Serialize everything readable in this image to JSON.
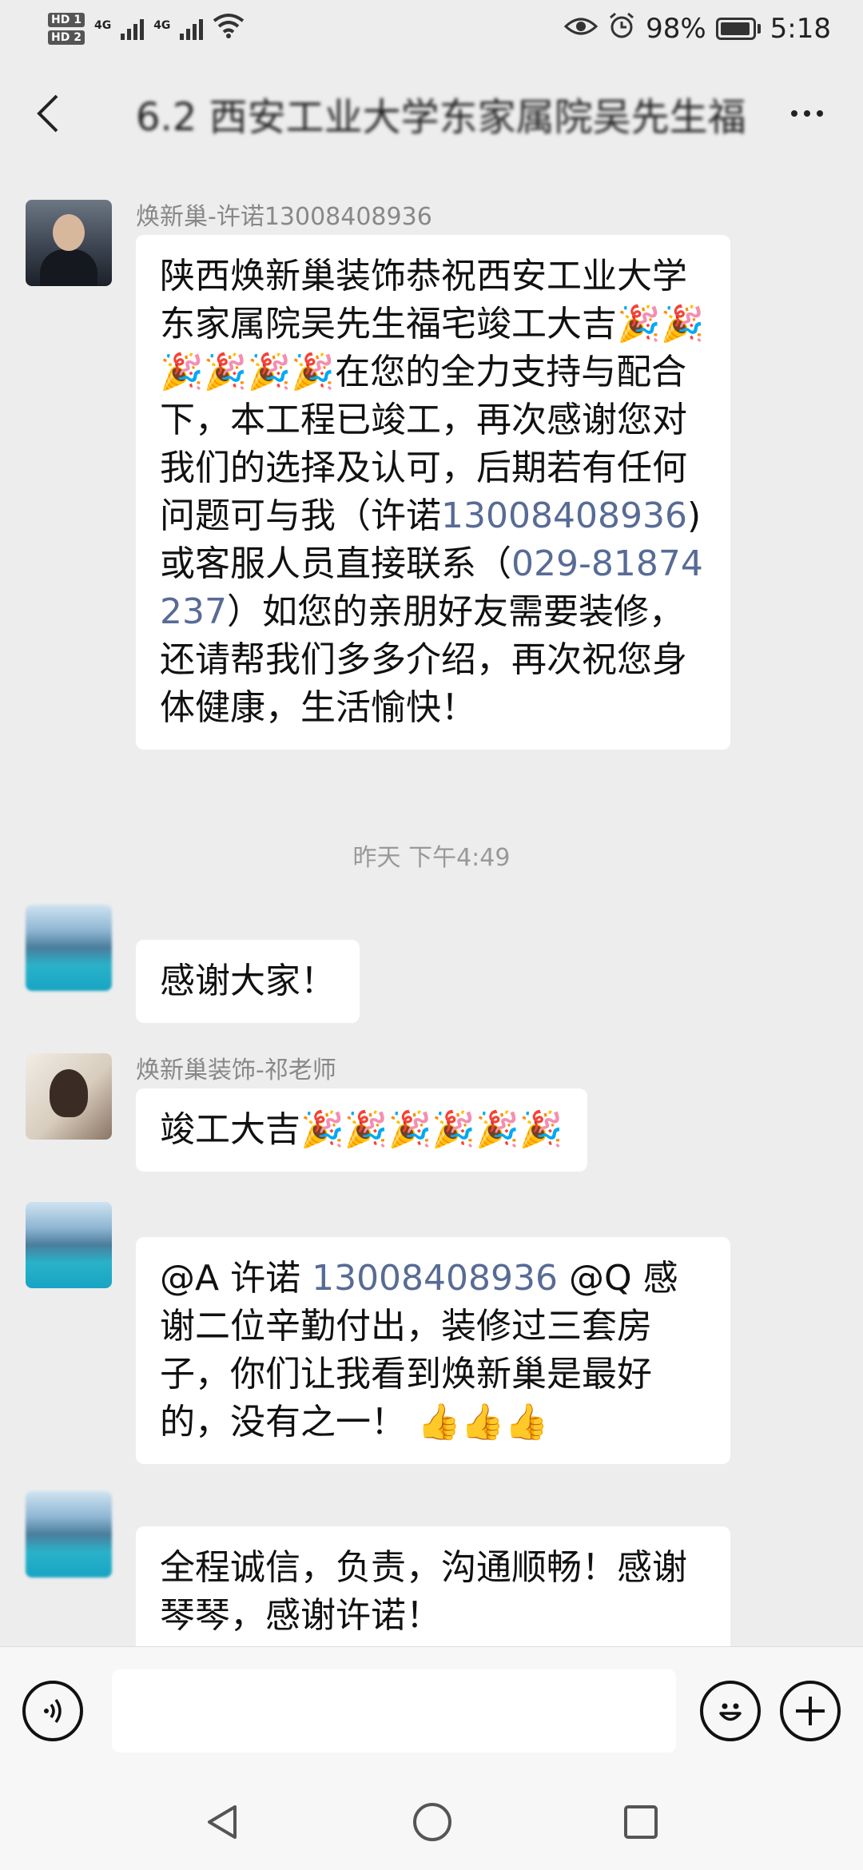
{
  "status_bar": {
    "hd1": "HD 1",
    "hd2": "HD 2",
    "sig1": "4G",
    "sig2": "4G",
    "battery": "98%",
    "time": "5:18"
  },
  "header": {
    "title": "6.2  西安工业大学东家属院吴先生福"
  },
  "messages": [
    {
      "sender": "焕新巢-许诺13008408936",
      "parts": [
        "陕西焕新巢装饰恭祝西安工业大学东家属院吴先生福宅竣工大吉🎉🎉🎉🎉🎉🎉在您的全力支持与配合下，本工程已竣工，再次感谢您对我们的选择及认可，后期若有任何问题可与我（许诺",
        "13008408936",
        ")或客服人员直接联系（",
        "029-81874237",
        "）如您的亲朋好友需要装修，还请帮我们多多介绍，再次祝您身体健康，生活愉快！"
      ]
    },
    {
      "sender": "",
      "text": "感谢大家！"
    },
    {
      "sender": "焕新巢装饰-祁老师",
      "text": "竣工大吉🎉🎉🎉🎉🎉🎉"
    },
    {
      "sender": "",
      "parts": [
        "@A 许诺 ",
        "13008408936",
        " @Q  感谢二位辛勤付出，装修过三套房子，你们让我看到焕新巢是最好的，没有之一！ 👍👍👍"
      ]
    },
    {
      "sender": "",
      "text": "全程诚信，负责，沟通顺畅！感谢琴琴，感谢许诺！"
    }
  ],
  "timestamp": "昨天 下午4:49",
  "input": {
    "placeholder": ""
  },
  "colors": {
    "background": "#ededed",
    "bubble": "#ffffff",
    "link": "#576b95",
    "meta_text": "#888888"
  }
}
